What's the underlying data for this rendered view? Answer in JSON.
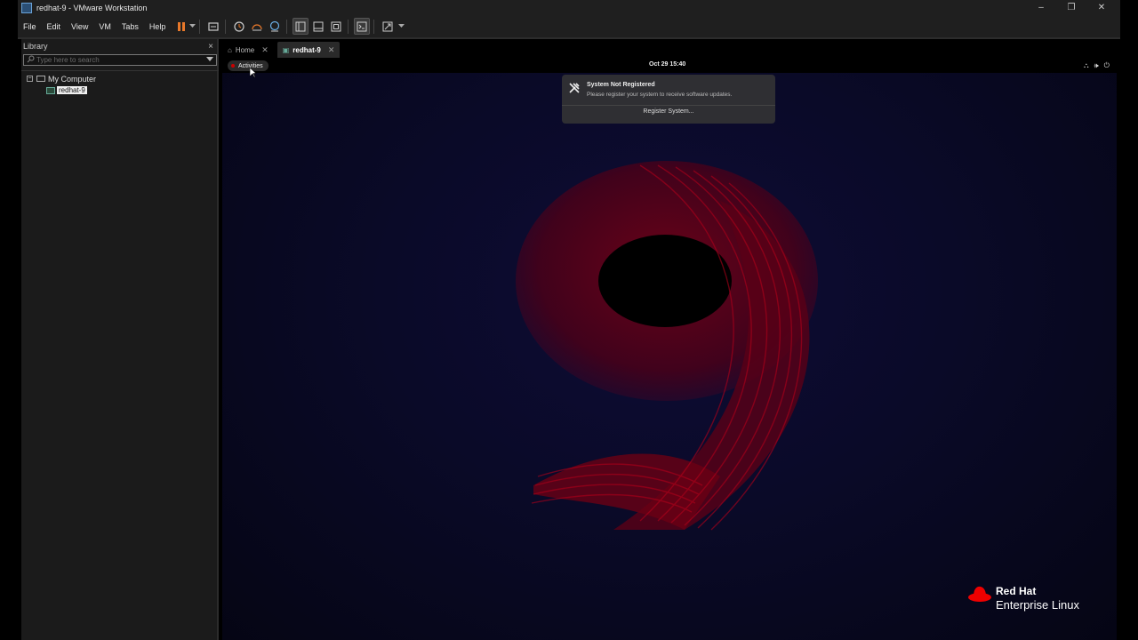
{
  "window": {
    "title": "redhat-9 - VMware Workstation",
    "controls": {
      "minimize": "–",
      "restore": "❐",
      "close": "✕"
    }
  },
  "menu": {
    "items": [
      "File",
      "Edit",
      "View",
      "VM",
      "Tabs",
      "Help"
    ]
  },
  "toolbar": {
    "icons": [
      "pause-icon",
      "dropdown-arrow-icon",
      "send-ctrl-alt-del-icon",
      "snapshot-icon",
      "revert-snapshot-icon",
      "snapshot-manager-icon",
      "show-library-icon",
      "thumbnail-bar-icon",
      "full-screen-icon",
      "console-view-icon",
      "stretch-guest-icon",
      "dropdown-arrow-icon"
    ],
    "accent": "#e8782a"
  },
  "library": {
    "title": "Library",
    "close": "×",
    "search_placeholder": "Type here to search",
    "tree": {
      "root_label": "My Computer",
      "expander": "−",
      "vm_label": "redhat-9"
    }
  },
  "tabs": [
    {
      "label": "Home",
      "close": "✕",
      "active": false
    },
    {
      "label": "redhat-9",
      "close": "✕",
      "active": true
    }
  ],
  "guest": {
    "activities": "Activities",
    "clock": "Oct 29  15:40",
    "sys_icons": [
      "network-icon",
      "volume-icon",
      "power-icon"
    ],
    "notification": {
      "title": "System Not Registered",
      "body": "Please register your system to receive software updates.",
      "action": "Register System..."
    },
    "brand": {
      "line1": "Red Hat",
      "line2": "Enterprise Linux",
      "logo_color": "#ee0000"
    },
    "wallpaper_accent": "#8a0010"
  }
}
